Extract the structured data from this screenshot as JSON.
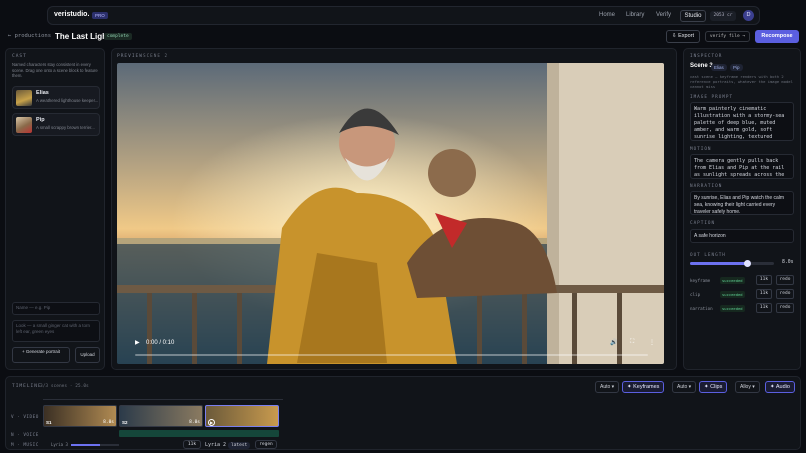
{
  "nav": {
    "logo": "veristudio.",
    "badge": "PRO",
    "links": [
      "Home",
      "Library",
      "Verify"
    ],
    "studio": "Studio",
    "credits": "2053 cr",
    "avatar": "D"
  },
  "header": {
    "back": "← productions",
    "title": "The Last Light",
    "status": "complete",
    "export": "⇩ Export",
    "verify": "verify file →",
    "recompose": "Recompose"
  },
  "cast": {
    "section": "CAST",
    "description": "Named characters stay consistent in every scene. Drag one onto a scene block to feature them.",
    "characters": [
      {
        "name": "Elias",
        "desc": "A weathered lighthouse keeper..."
      },
      {
        "name": "Pip",
        "desc": "A small scrappy brown terrier..."
      }
    ],
    "name_placeholder": "Name — e.g. Pip",
    "look_placeholder": "Look — a small ginger cat with a torn left ear, green eyes",
    "generate": "+ Generate portrait",
    "upload": "Upload"
  },
  "preview": {
    "section": "PREVIEW",
    "scene": "SCENE 2",
    "time": "0:00 / 0:10",
    "progress": 0.0
  },
  "inspector": {
    "section": "INSPECTOR",
    "scene": "Scene 3",
    "tags": [
      "Elias",
      "Pip"
    ],
    "note": "cast scene — keyframe renders with both 2 reference portraits, whatever the image model cannot miss",
    "image_prompt_label": "IMAGE PROMPT",
    "image_prompt": "Warm painterly cinematic illustration with a stormy-sea palette of deep blue, muted amber, and warm gold, soft sunrise lighting, textured",
    "motion_label": "MOTION",
    "motion": "The camera gently pulls back from Elias and Pip at the rail as sunlight spreads across the sea",
    "narration_label": "NARRATION",
    "narration": "By sunrise, Elias and Pip watch the calm sea, knowing their light carried every traveler safely home.",
    "caption_label": "CAPTION",
    "caption": "A safe horizon",
    "length": "8.0s",
    "length_fraction": 0.67,
    "outputs_label": "OUT LENGTH",
    "outputs": [
      {
        "k": "keyframe",
        "s": "succeeded",
        "n": "11k",
        "r": "redo"
      },
      {
        "k": "clip",
        "s": "succeeded",
        "n": "11k",
        "r": "redo"
      },
      {
        "k": "narration",
        "s": "succeeded",
        "n": "11k",
        "r": "redo"
      }
    ]
  },
  "timeline": {
    "section": "TIMELINE",
    "meta": "3/3 scenes · 25.0s",
    "mode1": "Auto",
    "keyframes": "Keyframes",
    "mode2": "Auto",
    "clips": "Clips",
    "voice": "Alloy",
    "audio": "Audio",
    "tracks": [
      "V · VIDEO",
      "N · VOICE",
      "M · MUSIC"
    ],
    "clips_list": [
      {
        "label": "S1",
        "dur": "8.0s"
      },
      {
        "label": "S2",
        "dur": "8.0s"
      },
      {
        "label": "S3",
        "dur": ""
      }
    ],
    "music_track": "Lyria 3",
    "music_num": "11k",
    "music_title": "Lyria 2",
    "latest": "latest",
    "regen": "regen"
  }
}
